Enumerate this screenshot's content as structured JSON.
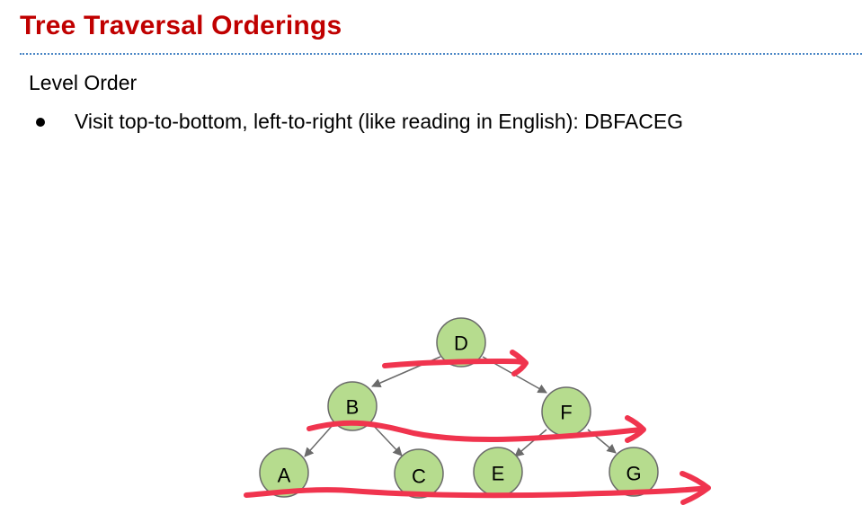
{
  "slide": {
    "title": "Tree Traversal Orderings"
  },
  "content": {
    "heading": "Level Order",
    "bullets": [
      {
        "text": "Visit top-to-bottom, left-to-right (like reading in English): DBFACEG"
      }
    ]
  },
  "tree": {
    "nodes": [
      {
        "id": "D",
        "label": "D"
      },
      {
        "id": "B",
        "label": "B"
      },
      {
        "id": "F",
        "label": "F"
      },
      {
        "id": "A",
        "label": "A"
      },
      {
        "id": "C",
        "label": "C"
      },
      {
        "id": "E",
        "label": "E"
      },
      {
        "id": "G",
        "label": "G"
      }
    ],
    "edges": [
      {
        "from": "D",
        "to": "B"
      },
      {
        "from": "D",
        "to": "F"
      },
      {
        "from": "B",
        "to": "A"
      },
      {
        "from": "B",
        "to": "C"
      },
      {
        "from": "F",
        "to": "E"
      },
      {
        "from": "F",
        "to": "G"
      }
    ]
  },
  "colors": {
    "title": "#c00000",
    "node_fill": "#b6dc8e",
    "node_stroke": "#6a6a6a",
    "sweep": "#f0344e",
    "rule": "#4a86c5"
  }
}
